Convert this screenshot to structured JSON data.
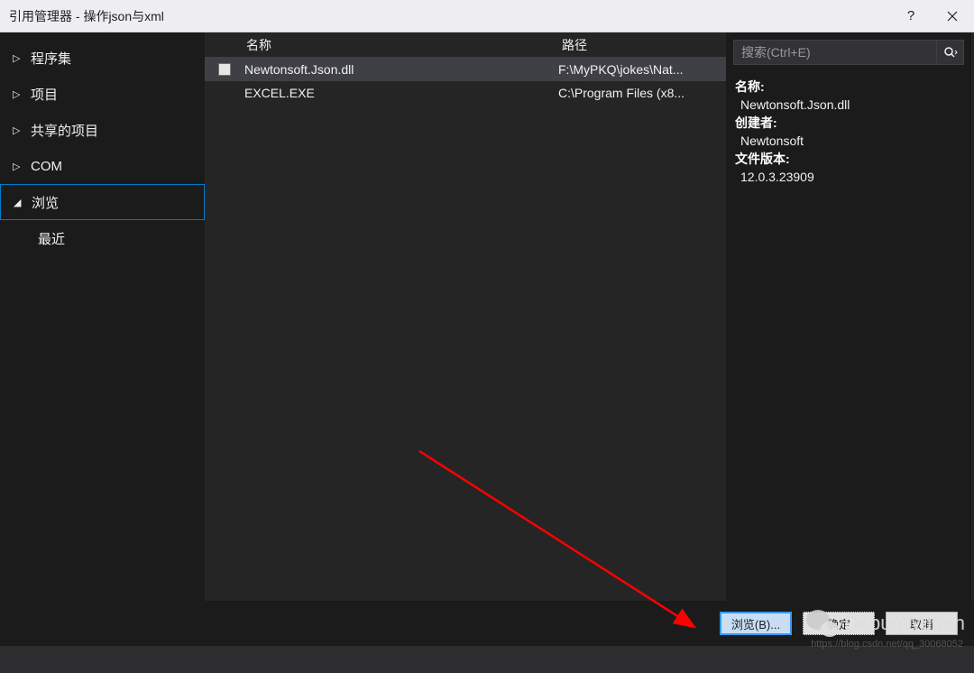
{
  "titlebar": {
    "title": "引用管理器 - 操作json与xml",
    "help": "?",
    "close": "×"
  },
  "sidebar": {
    "items": [
      {
        "label": "程序集",
        "expanded": false
      },
      {
        "label": "项目",
        "expanded": false
      },
      {
        "label": "共享的项目",
        "expanded": false
      },
      {
        "label": "COM",
        "expanded": false
      },
      {
        "label": "浏览",
        "expanded": true,
        "selected": true
      }
    ],
    "subitem": "最近"
  },
  "file_list": {
    "headers": {
      "name": "名称",
      "path": "路径"
    },
    "rows": [
      {
        "name": "Newtonsoft.Json.dll",
        "path": "F:\\MyPKQ\\jokes\\Nat...",
        "selected": true,
        "checked": false
      },
      {
        "name": "EXCEL.EXE",
        "path": "C:\\Program Files (x8...",
        "selected": false,
        "checked": false
      }
    ]
  },
  "search": {
    "placeholder": "搜索(Ctrl+E)"
  },
  "details": {
    "name_label": "名称:",
    "name_value": "Newtonsoft.Json.dll",
    "creator_label": "创建者:",
    "creator_value": "Newtonsoft",
    "version_label": "文件版本:",
    "version_value": "12.0.3.23909"
  },
  "footer": {
    "browse": "浏览(B)...",
    "ok": "确定",
    "cancel": "取消"
  },
  "watermark": {
    "text": "DebugWuhen",
    "url": "https://blog.csdn.net/qq_30068052"
  }
}
